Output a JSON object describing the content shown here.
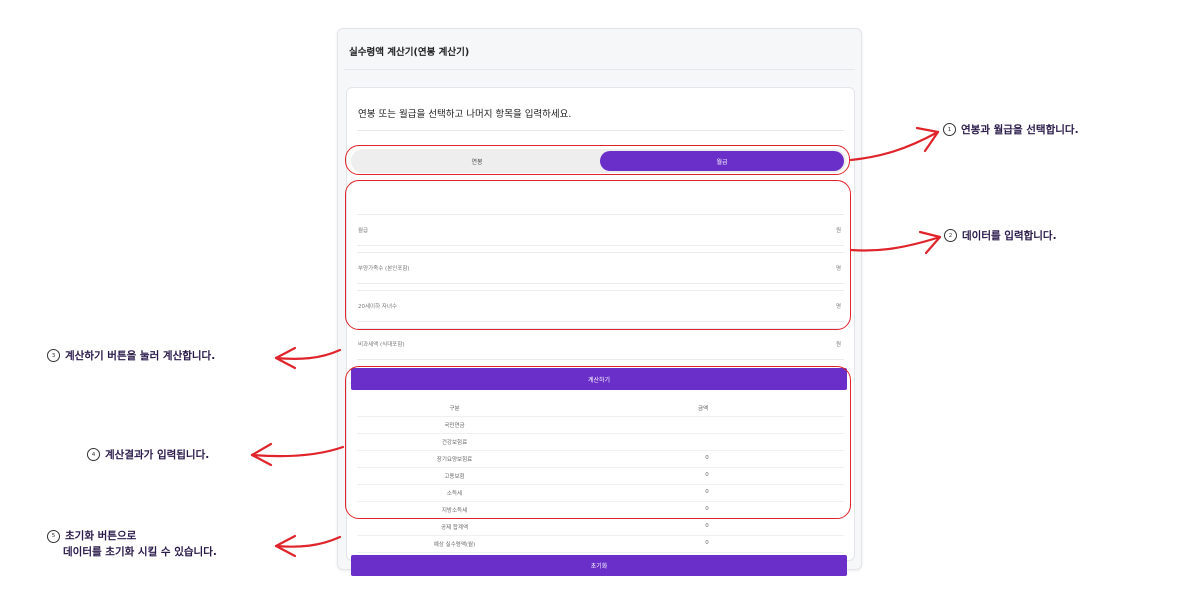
{
  "card": {
    "title": "실수령액 계산기(연봉 계산기)",
    "instruction": "연봉 또는 월급을 선택하고 나머지 항목을 입력하세요."
  },
  "toggle": {
    "left": "연봉",
    "right": "월급",
    "selected": "월급"
  },
  "fields": [
    {
      "label": "월급",
      "unit": "원"
    },
    {
      "label": "부양가족수 (본인포함)",
      "unit": "명"
    },
    {
      "label": "20세이하 자녀수",
      "unit": "명"
    },
    {
      "label": "비과세액 (식대포함)",
      "unit": "원"
    }
  ],
  "calculate_button": "계산하기",
  "results": {
    "headers": [
      "구분",
      "금액"
    ],
    "rows": [
      {
        "name": "국민연금",
        "value": ""
      },
      {
        "name": "건강보험료",
        "value": ""
      },
      {
        "name": "장기요양보험료",
        "value": "0"
      },
      {
        "name": "고용보험",
        "value": "0"
      },
      {
        "name": "소득세",
        "value": "0"
      },
      {
        "name": "지방소득세",
        "value": "0"
      },
      {
        "name": "공제 합계액",
        "value": "0"
      },
      {
        "name": "예상 실수령액(월)",
        "value": "0"
      }
    ]
  },
  "reset_button": "초기화",
  "annotations": [
    {
      "num": "1",
      "text": "연봉과 월급을 선택합니다."
    },
    {
      "num": "2",
      "text": "데이터를 입력합니다."
    },
    {
      "num": "3",
      "text": "계산하기 버튼을 눌러 계산합니다."
    },
    {
      "num": "4",
      "text": "계산결과가 입력됩니다."
    },
    {
      "num": "5",
      "line1": "초기화 버튼으로",
      "line2": "데이터를 초기화 시킬 수 있습니다."
    }
  ],
  "colors": {
    "accent": "#6a2fc9",
    "highlight": "#e0242b",
    "annotation_text": "#2a1a4a"
  }
}
